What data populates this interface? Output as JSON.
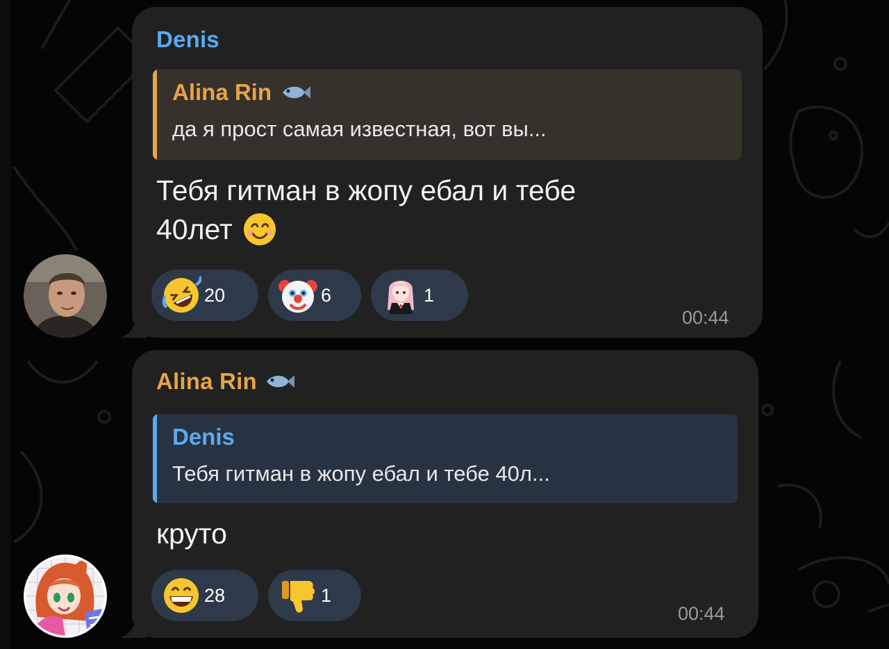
{
  "messages": [
    {
      "sender": "Denis",
      "reply": {
        "name": "Alina Rin",
        "text": "да я прост самая известная, вот вы..."
      },
      "text_line1": "Тебя гитман в жопу ебал и тебе",
      "text_line2": "40лет",
      "reactions": [
        {
          "icon": "rofl-face-icon",
          "count": "20"
        },
        {
          "icon": "clown-face-icon",
          "count": "6"
        },
        {
          "icon": "anime-girl-sticker-icon",
          "count": "1"
        }
      ],
      "time": "00:44"
    },
    {
      "sender": "Alina Rin",
      "reply": {
        "name": "Denis",
        "text": "Тебя гитман в жопу ебал и тебе 40л..."
      },
      "text_line1": "круто",
      "reactions": [
        {
          "icon": "grinning-face-icon",
          "count": "28"
        },
        {
          "icon": "thumbs-down-icon",
          "count": "1"
        }
      ],
      "time": "00:44"
    }
  ],
  "colors": {
    "background": "#050505",
    "bubble": "#212121",
    "denis_name": "#5aaaf0",
    "alina_name": "#e6a448",
    "reaction_pill": "#2e3a49"
  }
}
